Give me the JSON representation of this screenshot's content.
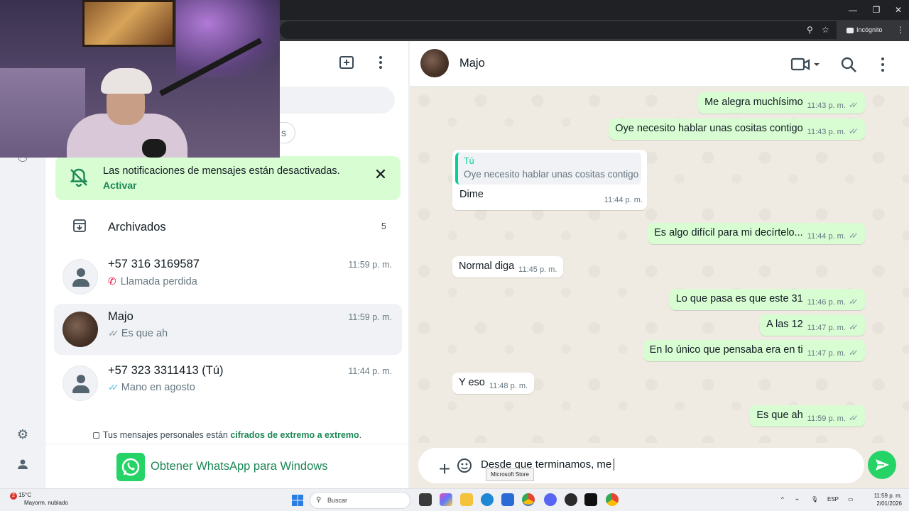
{
  "browser": {
    "incognito_label": "Incógnito",
    "window_controls": {
      "minimize": "—",
      "restore": "❐",
      "close": "✕"
    }
  },
  "sidebar": {
    "filter_chip": "s"
  },
  "notification": {
    "text": "Las notificaciones de mensajes están desactivadas.",
    "action": "Activar",
    "close": "✕"
  },
  "archived": {
    "label": "Archivados",
    "count": "5"
  },
  "chats": [
    {
      "name": "+57 316 3169587",
      "time": "11:59 p. m.",
      "preview": "Llamada perdida",
      "status_icon": "missed-call-icon"
    },
    {
      "name": "Majo",
      "time": "11:59 p. m.",
      "preview": "Es que ah",
      "status_icon": "double-check-grey",
      "active": true
    },
    {
      "name": "+57 323 3311413 (Tú)",
      "time": "11:44 p. m.",
      "preview": "Mano en agosto",
      "status_icon": "double-check-blue"
    }
  ],
  "encryption": {
    "prefix": "Tus mensajes personales están ",
    "link": "cifrados de extremo a extremo",
    "suffix": "."
  },
  "get_app": {
    "label": "Obtener WhatsApp para Windows"
  },
  "conversation": {
    "contact_name": "Majo",
    "messages": [
      {
        "dir": "out",
        "text": "Me alegra muchísimo",
        "time": "11:43 p. m."
      },
      {
        "dir": "out",
        "text": "Oye necesito hablar unas cositas contigo",
        "time": "11:43 p. m."
      },
      {
        "dir": "in",
        "quote_author": "Tú",
        "quote_text": "Oye necesito hablar unas cositas contigo",
        "text": "Dime",
        "time": "11:44 p. m."
      },
      {
        "dir": "out",
        "text": "Es algo difícil para mi decírtelo...",
        "time": "11:44 p. m."
      },
      {
        "dir": "in",
        "text": "Normal diga",
        "time": "11:45 p. m."
      },
      {
        "dir": "out",
        "text": "Lo que pasa es que este 31",
        "time": "11:46 p. m."
      },
      {
        "dir": "out",
        "text": "A las 12",
        "time": "11:47 p. m."
      },
      {
        "dir": "out",
        "text": "En lo único que pensaba era en ti",
        "time": "11:47 p. m."
      },
      {
        "dir": "in",
        "text": "Y eso",
        "time": "11:48 p. m."
      },
      {
        "dir": "out",
        "text": "Es que ah",
        "time": "11:59 p. m."
      }
    ],
    "composer_text": "Desde que terminamos, me"
  },
  "tooltip": "Microsoft Store",
  "taskbar": {
    "weather_badge": "2",
    "weather_temp": "15°C",
    "weather_desc": "Mayorm. nublado",
    "search_placeholder": "Buscar",
    "language": "ESP",
    "time": "11:59 p. m.",
    "date": "2/01/2026"
  },
  "colors": {
    "accent": "#25d366",
    "outgoing_bubble": "#d9fdd3",
    "link_green": "#1b8755",
    "read_tick_blue": "#53bdeb"
  }
}
